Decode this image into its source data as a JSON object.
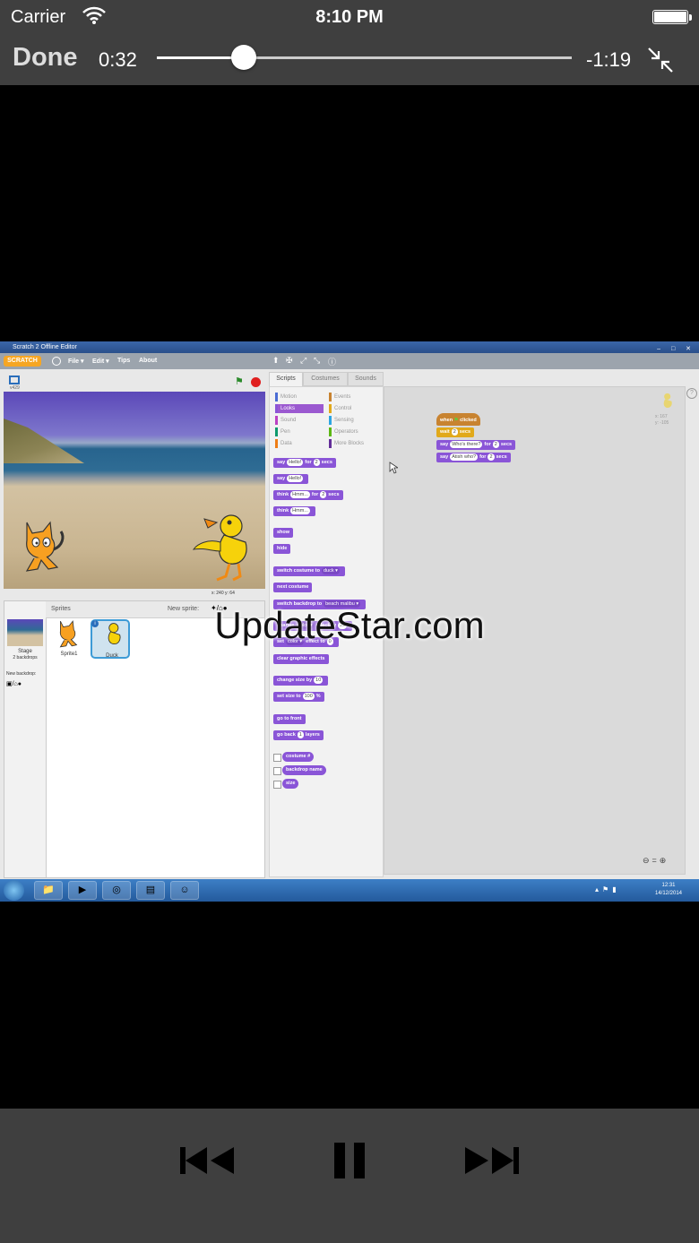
{
  "status_bar": {
    "carrier": "Carrier",
    "time": "8:10 PM"
  },
  "player": {
    "done_label": "Done",
    "elapsed": "0:32",
    "remaining": "-1:19",
    "progress": 0.21,
    "watermark": "UpdateStar.com"
  },
  "app": {
    "window_title": "Scratch 2 Offline Editor",
    "logo": "SCRATCH",
    "menu": [
      "File ▾",
      "Edit ▾",
      "Tips",
      "About"
    ],
    "version": "v429",
    "coords": "x: 240   y: 64",
    "tabs": [
      "Scripts",
      "Costumes",
      "Sounds"
    ],
    "categories_left": [
      "Motion",
      "Looks",
      "Sound",
      "Pen",
      "Data"
    ],
    "categories_right": [
      "Events",
      "Control",
      "Sensing",
      "Operators",
      "More Blocks"
    ],
    "sprites_label": "Sprites",
    "new_sprite_label": "New sprite:",
    "stage_label": "Stage",
    "stage_backdrops": "2 backdrops",
    "new_backdrop_label": "New backdrop:",
    "sprites": [
      "Sprite1",
      "Duck"
    ],
    "sprite_pos_x": "x: 167",
    "sprite_pos_y": "y: -105"
  },
  "blocks": {
    "say_for_a": "say",
    "say_for_val": "Hello!",
    "say_for_b": "for",
    "say_for_num": "2",
    "say_for_c": "secs",
    "say_a": "say",
    "say_val": "Hello!",
    "think_for_a": "think",
    "think_for_val": "Hmm...",
    "think_for_b": "for",
    "think_for_num": "2",
    "think_for_c": "secs",
    "think_a": "think",
    "think_val": "Hmm...",
    "show": "show",
    "hide": "hide",
    "switch_costume": "switch costume to",
    "switch_costume_val": "duck ▾",
    "next_costume": "next costume",
    "switch_backdrop": "switch backdrop to",
    "switch_backdrop_val": "beach malibu ▾",
    "change_effect_a": "change",
    "change_effect_val": "color ▾",
    "change_effect_b": "effect by",
    "change_effect_num": "25",
    "set_effect_a": "set",
    "set_effect_val": "color ▾",
    "set_effect_b": "effect to",
    "set_effect_num": "0",
    "clear_effects": "clear graphic effects",
    "change_size": "change size by",
    "change_size_num": "10",
    "set_size_a": "set size to",
    "set_size_num": "100",
    "set_size_b": "%",
    "go_front": "go to front",
    "go_back_a": "go back",
    "go_back_num": "1",
    "go_back_b": "layers",
    "costume_num": "costume #",
    "backdrop_name": "backdrop name",
    "size": "size"
  },
  "script": {
    "when_a": "when",
    "when_b": "clicked",
    "wait_a": "wait",
    "wait_num": "2",
    "wait_b": "secs",
    "say1_a": "say",
    "say1_val": "Who's there?",
    "say1_b": "for",
    "say1_num": "2",
    "say1_c": "secs",
    "say2_a": "say",
    "say2_val": "Atish who?",
    "say2_b": "for",
    "say2_num": "2",
    "say2_c": "secs"
  },
  "taskbar": {
    "time": "12:31",
    "date": "14/12/2014"
  },
  "colors": {
    "looks": "#8a55d7",
    "events": "#c88330",
    "control": "#e1a91a",
    "bar": "#3f3f3f"
  }
}
